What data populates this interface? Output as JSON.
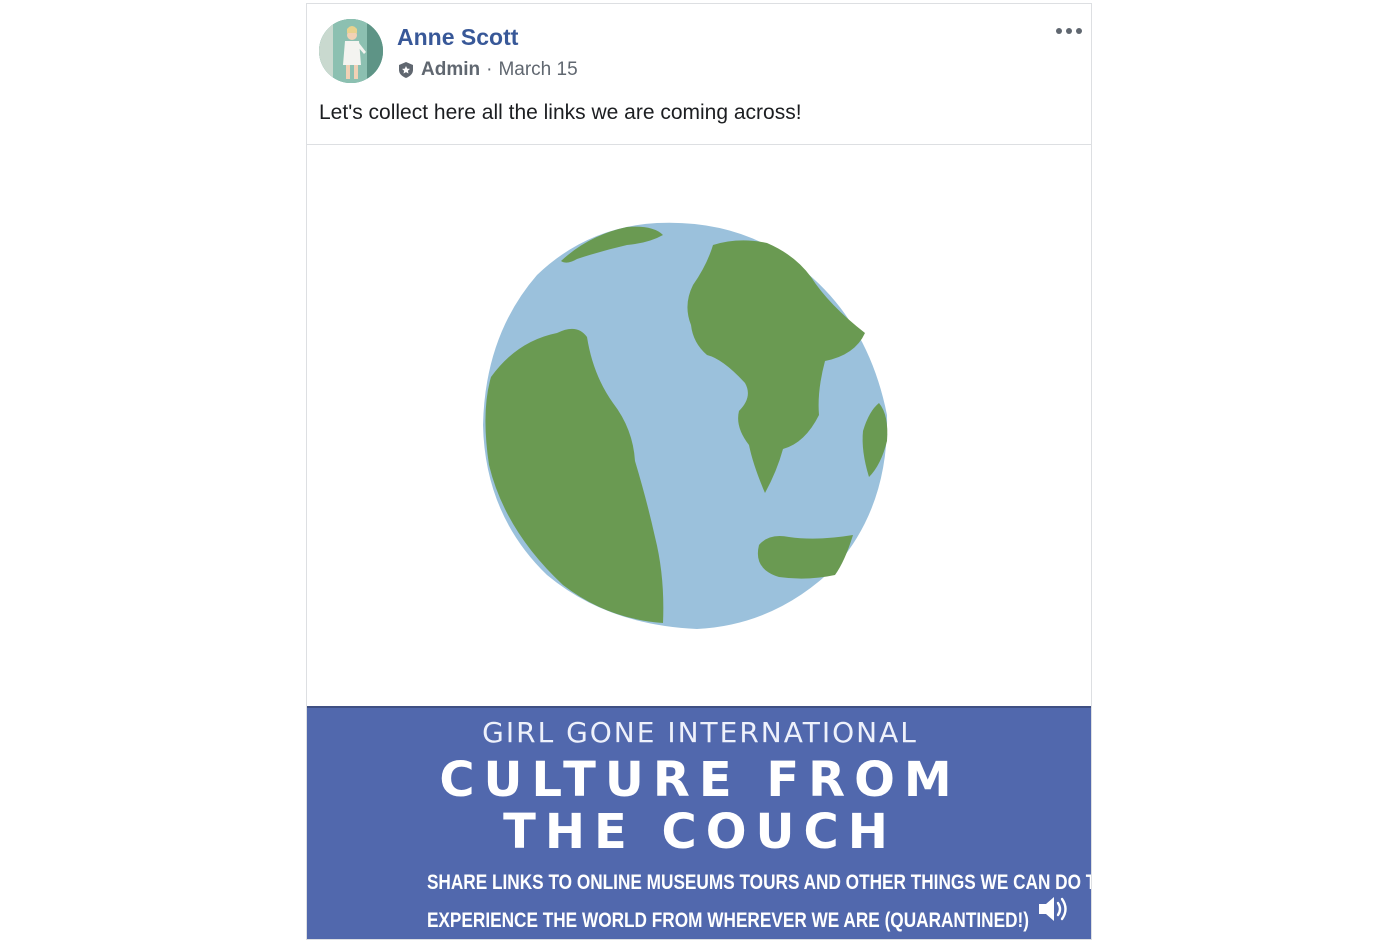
{
  "post": {
    "author": "Anne Scott",
    "role": "Admin",
    "separator": "·",
    "date": "March 15",
    "text": "Let's collect here all the links we are coming across!",
    "avatar_icon": "profile-photo",
    "more_icon": "more-options-icon"
  },
  "video": {
    "banner_kicker": "GIRL GONE INTERNATIONAL",
    "banner_title_line1": "CULTURE FROM",
    "banner_title_line2": "THE COUCH",
    "banner_sub_line1": "SHARE LINKS TO ONLINE MUSEUMS TOURS AND OTHER THINGS WE CAN DO TO",
    "banner_sub_line2": "EXPERIENCE THE WORLD FROM WHEREVER WE ARE (QUARANTINED!)",
    "volume_icon": "volume-icon",
    "colors": {
      "banner": "#5168ad",
      "ocean": "#9bc1dc",
      "land": "#6a9a52",
      "link": "#385898"
    }
  }
}
